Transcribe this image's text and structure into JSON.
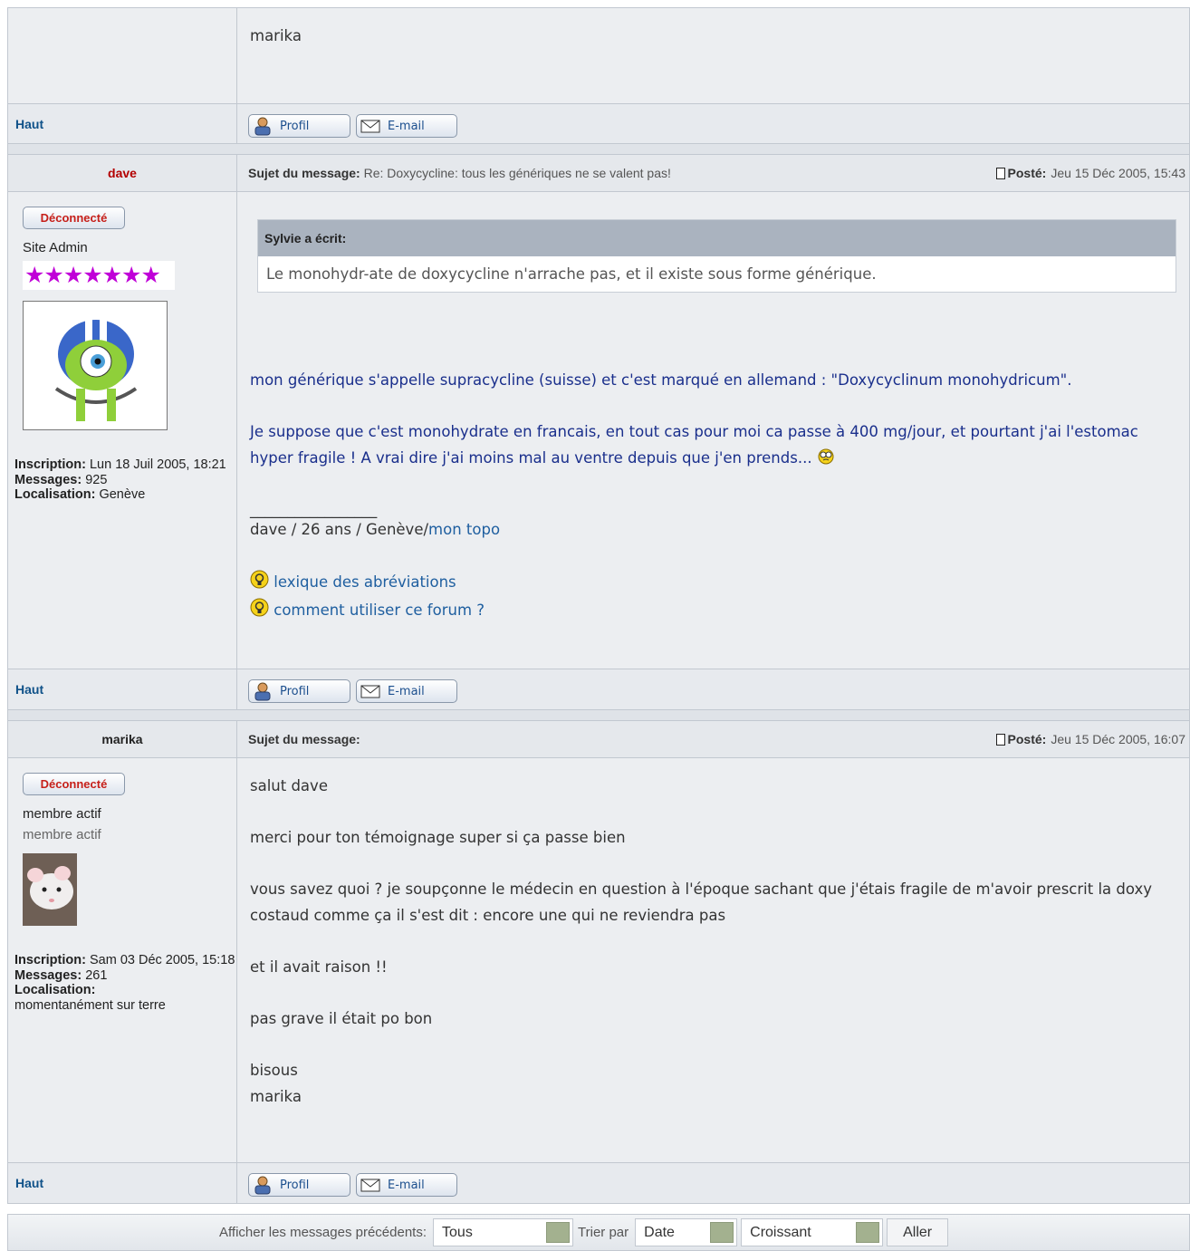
{
  "post_prev": {
    "signature": "marika",
    "footer": {
      "top_link": "Haut",
      "profile_btn": "Profil",
      "email_btn": "E-mail"
    }
  },
  "post_dave": {
    "author": "dave",
    "author_color": "#b30000",
    "subject_label": "Sujet du message:",
    "subject": "Re: Doxycycline: tous les génériques ne se valent pas!",
    "posted_label": "Posté:",
    "posted": "Jeu 15 Déc 2005, 15:43",
    "status_badge": "Déconnecté",
    "rank": "Site Admin",
    "stars": "★★★★★★★",
    "avatar": "avatar-cyclops-helmet",
    "inscription_label": "Inscription:",
    "inscription": "Lun 18 Juil 2005, 18:21",
    "messages_label": "Messages:",
    "messages": "925",
    "location_label": "Localisation:",
    "location": "Genève",
    "quote_author": "Sylvie a écrit:",
    "quote_text": "Le monohydr-ate de doxycycline n'arrache pas, et il existe sous forme générique.",
    "para1": "mon générique s'appelle supracycline (suisse) et c'est marqué en allemand : \"Doxycyclinum monohydricum\".",
    "para2": "Je suppose que c'est monohydrate en francais, en tout cas pour moi ca passe à 400 mg/jour, et pourtant j'ai l'estomac hyper fragile ! A vrai dire j'ai moins mal au ventre depuis que j'en prends...",
    "sig_line": "_________________",
    "sig_text": "dave / 26 ans / Genève/",
    "sig_link": "mon topo",
    "link1": "lexique des abréviations",
    "link2": "comment utiliser ce forum ?",
    "footer": {
      "top_link": "Haut",
      "profile_btn": "Profil",
      "email_btn": "E-mail"
    }
  },
  "post_marika": {
    "author": "marika",
    "subject_label": "Sujet du message:",
    "posted_label": "Posté:",
    "posted": "Jeu 15 Déc 2005, 16:07",
    "status_badge": "Déconnecté",
    "rank": "membre actif",
    "rank2": "membre actif",
    "avatar": "avatar-white-rat",
    "inscription_label": "Inscription:",
    "inscription": "Sam 03 Déc 2005, 15:18",
    "messages_label": "Messages:",
    "messages": "261",
    "location_label": "Localisation:",
    "location": "momentanément sur terre",
    "p1": "salut dave",
    "p2": "merci pour ton témoignage super si ça passe bien",
    "p3": "vous savez quoi ? je soupçonne le médecin en question à l'époque sachant que j'étais fragile de m'avoir prescrit la doxy costaud comme ça il s'est dit : encore une qui ne reviendra pas",
    "p4": "et il avait raison !!",
    "p5": "pas grave il était po bon",
    "p6a": "bisous",
    "p6b": "marika",
    "footer": {
      "top_link": "Haut",
      "profile_btn": "Profil",
      "email_btn": "E-mail"
    }
  },
  "display_bar": {
    "show_label": "Afficher les messages précédents:",
    "show_value": "Tous",
    "sort_label": "Trier par",
    "sort_value": "Date",
    "order_value": "Croissant",
    "go_button": "Aller"
  }
}
